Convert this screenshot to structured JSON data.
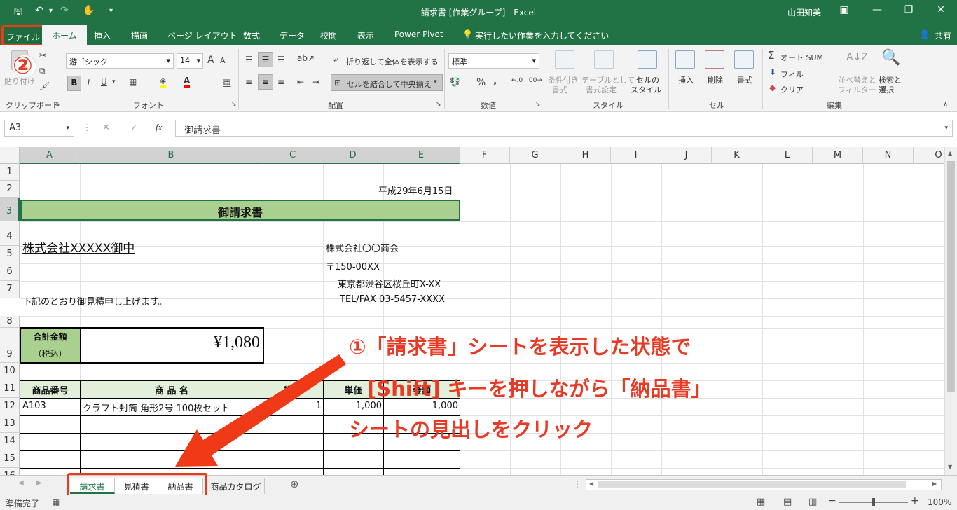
{
  "window": {
    "title": "請求書 [作業グループ] - Excel",
    "user": "山田知美"
  },
  "tabs": {
    "file": "ファイル",
    "home": "ホーム",
    "insert": "挿入",
    "draw": "描画",
    "layout": "ページ レイアウト",
    "formulas": "数式",
    "data": "データ",
    "review": "校閲",
    "view": "表示",
    "powerpivot": "Power Pivot",
    "tellme": "実行したい作業を入力してください",
    "share": "共有"
  },
  "ribbon": {
    "clipboard": {
      "label": "クリップボード",
      "paste": "貼り付け"
    },
    "font": {
      "label": "フォント",
      "name": "游ゴシック",
      "size": "14",
      "bold": "B",
      "italic": "I",
      "underline": "U",
      "grow": "A",
      "shrink": "A",
      "phonetic": "亜"
    },
    "alignment": {
      "label": "配置",
      "wrap": "折り返して全体を表示する",
      "merge": "セルを結合して中央揃え"
    },
    "number": {
      "label": "数値",
      "format": "標準",
      "percent": "%",
      "comma": ","
    },
    "styles": {
      "label": "スタイル",
      "conditional1": "条件付き",
      "conditional2": "書式",
      "table1": "テーブルとして",
      "table2": "書式設定",
      "cell1": "セルの",
      "cell2": "スタイル"
    },
    "cells": {
      "label": "セル",
      "insert": "挿入",
      "delete": "削除",
      "format": "書式"
    },
    "editing": {
      "label": "編集",
      "autosum": "オート SUM",
      "fill": "フィル",
      "clear": "クリア",
      "sort1": "並べ替えと",
      "sort2": "フィルター",
      "find1": "検索と",
      "find2": "選択"
    }
  },
  "formula_bar": {
    "name_box": "A3",
    "formula": "御請求書"
  },
  "columns": [
    "A",
    "B",
    "C",
    "D",
    "E",
    "F",
    "G",
    "H",
    "I",
    "J",
    "K",
    "L",
    "M",
    "N",
    "O"
  ],
  "rows": [
    "1",
    "2",
    "3",
    "4",
    "5",
    "6",
    "7",
    "8",
    "9",
    "10",
    "11",
    "12",
    "13",
    "14",
    "15",
    "16"
  ],
  "cells": {
    "date": "平成29年6月15日",
    "title": "御請求書",
    "customer": "株式会社XXXXX御中",
    "company": "株式会社〇〇商会",
    "postal": "〒150-00XX",
    "address": "東京都渋谷区桜丘町X-XX",
    "telfax": "TEL/FAX 03-5457-XXXX",
    "note": "下記のとおり御見積申し上げます。",
    "total_label1": "合計金額",
    "total_label2": "（税込）",
    "total_value": "¥1,080",
    "h_code": "商品番号",
    "h_name": "商 品 名",
    "h_qty": "数量",
    "h_price": "単価",
    "h_amount": "金額",
    "r_code": "A103",
    "r_name": "クラフト封筒 角形2号 100枚セット",
    "r_qty": "1",
    "r_price": "1,000",
    "r_amount": "1,000"
  },
  "annotation": {
    "step1_line1": "①「請求書」シートを表示した状態で",
    "step1_line2": "[Shift] キーを押しながら「納品書」",
    "step1_line3": "シートの見出しをクリック",
    "step2": "②"
  },
  "sheets": [
    "請求書",
    "見積書",
    "納品書",
    "商品カタログ"
  ],
  "status": {
    "ready": "準備完了",
    "zoom": "100%"
  },
  "colors": {
    "excel_green": "#217346",
    "annotation_red": "#e83b25",
    "title_fill": "#a9d08e",
    "header_fill": "#e2efda"
  }
}
